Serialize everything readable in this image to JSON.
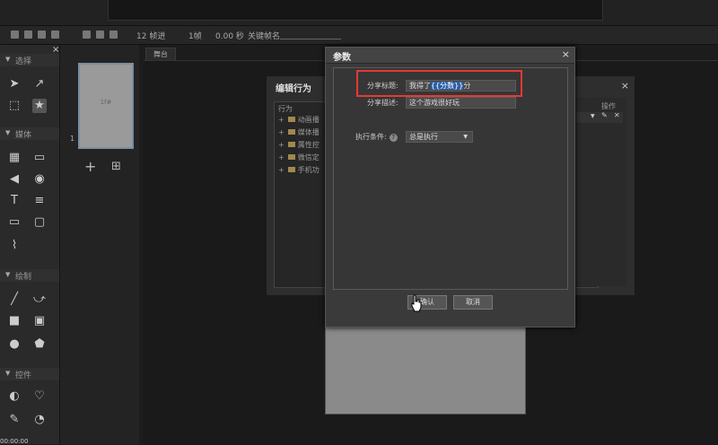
{
  "toolbar": {
    "frames": "12 帧进",
    "frame": "1帧",
    "seconds": "0.00 秒",
    "keyframe_name": "关键帧名"
  },
  "tool_sections": {
    "select": "选择",
    "media": "媒体",
    "draw": "绘制",
    "controls": "控件"
  },
  "scene": {
    "thumb_label": "1f#",
    "index": "1"
  },
  "stage": {
    "tab_label": "舞台"
  },
  "behavior_panel": {
    "title": "编辑行为",
    "tree_header": "行为",
    "items": [
      "动画播",
      "媒体播",
      "属性控",
      "微信定",
      "手机功"
    ],
    "op_header": "操作"
  },
  "dialog": {
    "title": "参数",
    "share_title_label": "分享标题:",
    "share_title_value_prefix": "我得了",
    "share_title_value_highlight": "{{分数}}",
    "share_title_value_suffix": "分",
    "share_desc_label": "分享描述:",
    "share_desc_value": "这个游戏很好玩",
    "condition_label": "执行条件:",
    "condition_help": "?",
    "condition_value": "总是执行",
    "confirm_label": "确认",
    "cancel_label": "取消"
  },
  "footer": {
    "timecode": "00:00:00"
  },
  "colors": {
    "highlight_box": "#e53935",
    "selection": "#2d5fa8"
  }
}
